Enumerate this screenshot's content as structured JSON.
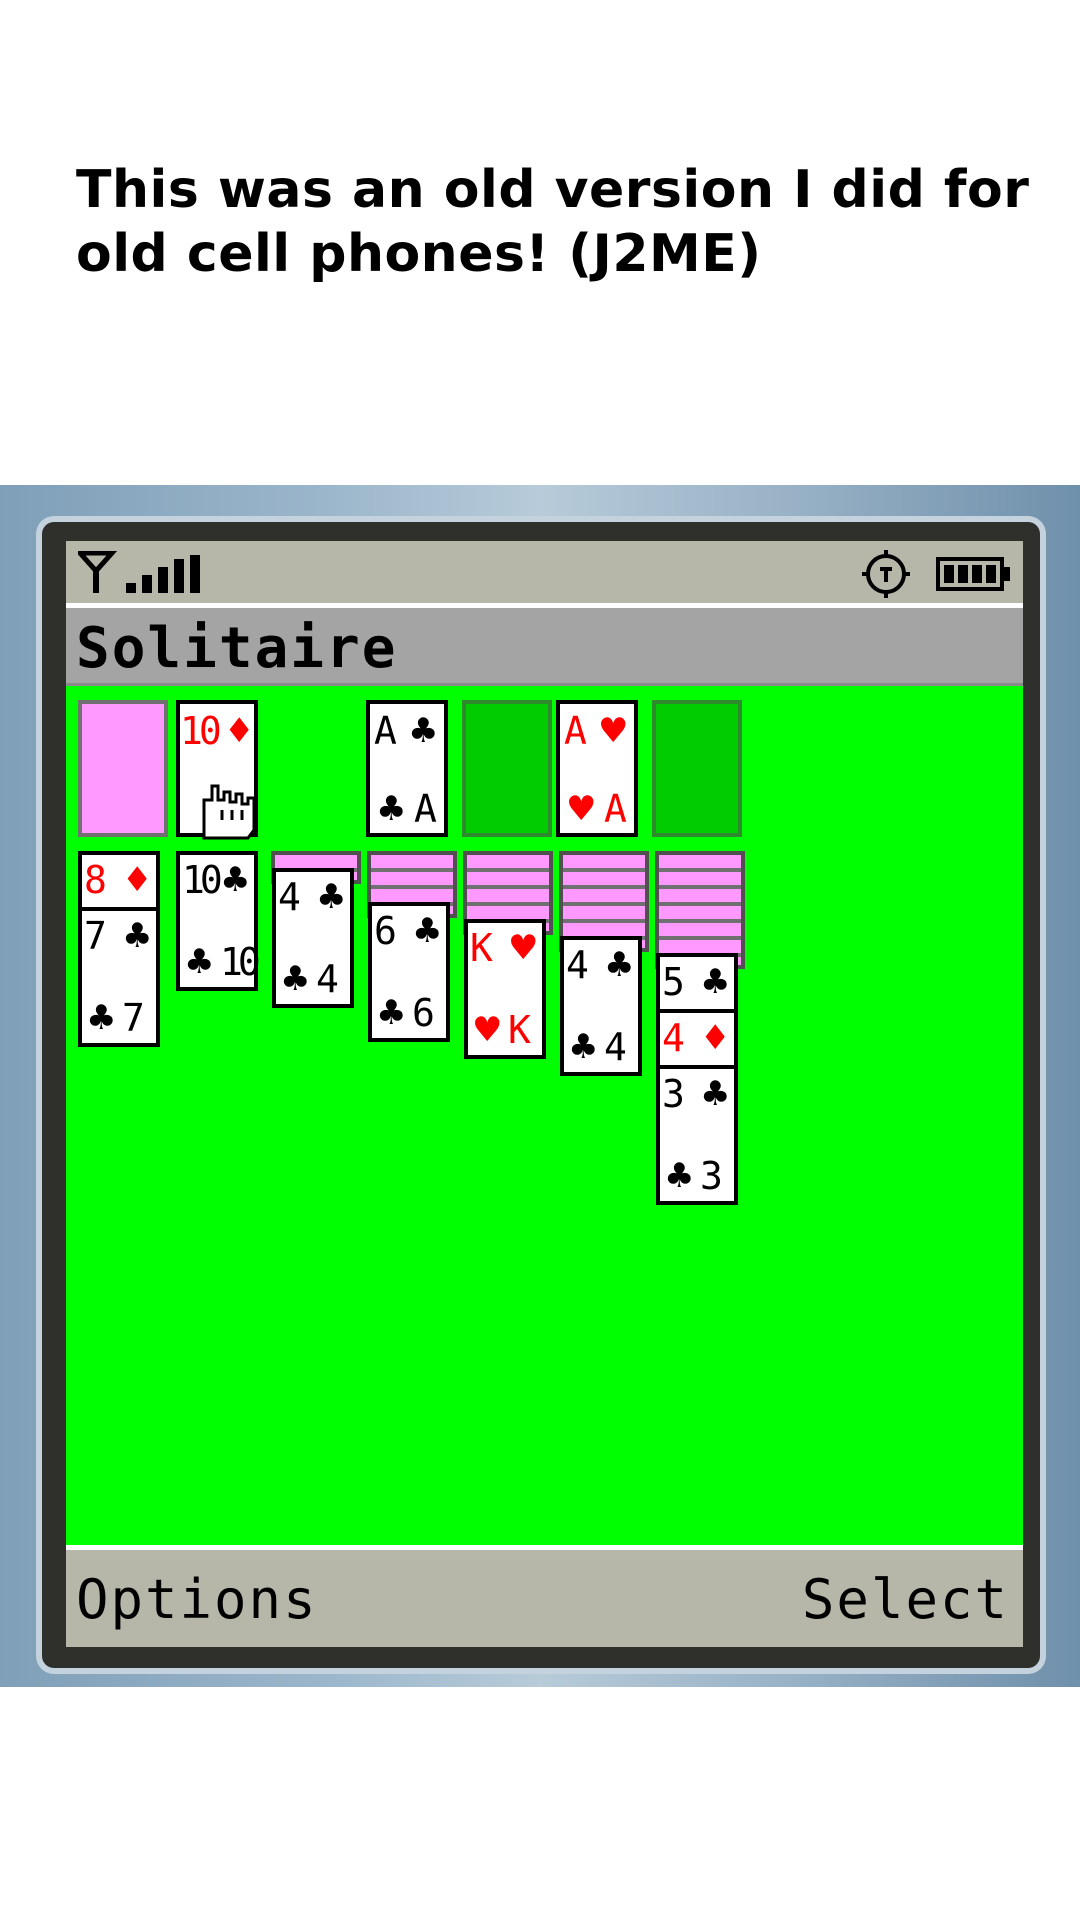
{
  "caption": "This was an old version I did for old cell phones! (J2ME)",
  "app": {
    "title": "Solitaire"
  },
  "softkeys": {
    "left": "Options",
    "right": "Select"
  },
  "status": {
    "signal_icon": "antenna-signal-icon",
    "nav_icon": "navigation-icon",
    "battery_icon": "battery-icon",
    "signal_level": 4
  },
  "colors": {
    "felt": "#00ff00",
    "card_back": "#ff99ff",
    "empty_slot": "#00cc00",
    "red_suit": "#ff0000",
    "bar": "#b6b6a9"
  },
  "top_row": {
    "stock": {
      "state": "face-down"
    },
    "waste": {
      "rank": "10",
      "suit": "♦",
      "color": "red"
    },
    "foundations": [
      {
        "rank": "A",
        "suit": "♣",
        "color": "black"
      },
      {
        "state": "empty"
      },
      {
        "rank": "A",
        "suit": "♥",
        "color": "red"
      },
      {
        "state": "empty"
      }
    ]
  },
  "tableau": [
    {
      "hidden": 0,
      "cards": [
        {
          "rank": "8",
          "suit": "♦",
          "color": "red"
        },
        {
          "rank": "7",
          "suit": "♣",
          "color": "black"
        }
      ]
    },
    {
      "hidden": 0,
      "cards": [
        {
          "rank": "10",
          "suit": "♣",
          "color": "black"
        }
      ]
    },
    {
      "hidden": 1,
      "cards": [
        {
          "rank": "4",
          "suit": "♣",
          "color": "black"
        }
      ]
    },
    {
      "hidden": 3,
      "cards": [
        {
          "rank": "6",
          "suit": "♣",
          "color": "black"
        }
      ]
    },
    {
      "hidden": 4,
      "cards": [
        {
          "rank": "K",
          "suit": "♥",
          "color": "red"
        }
      ]
    },
    {
      "hidden": 5,
      "cards": [
        {
          "rank": "4",
          "suit": "♣",
          "color": "black"
        }
      ]
    },
    {
      "hidden": 6,
      "cards": [
        {
          "rank": "5",
          "suit": "♣",
          "color": "black"
        },
        {
          "rank": "4",
          "suit": "♦",
          "color": "red"
        },
        {
          "rank": "3",
          "suit": "♣",
          "color": "black"
        }
      ]
    }
  ],
  "cursor": {
    "icon": "hand-pointer-icon",
    "target": "waste"
  }
}
